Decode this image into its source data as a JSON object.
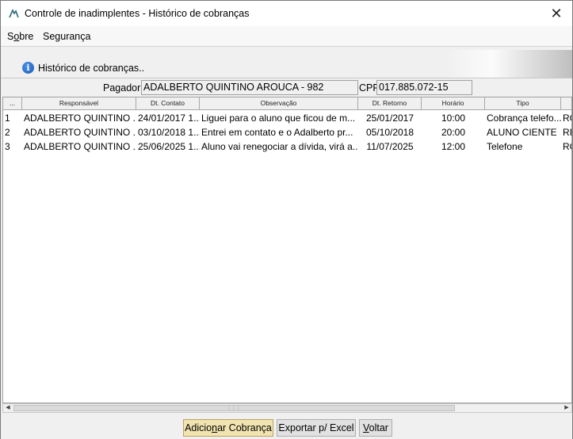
{
  "window": {
    "title": "Controle de inadimplentes - Histórico de cobranças",
    "close_glyph": "✕"
  },
  "menu": {
    "items": [
      {
        "pre": "S",
        "ul": "o",
        "post": "bre"
      },
      {
        "pre": "Segurança",
        "ul": "",
        "post": ""
      }
    ]
  },
  "banner": {
    "caption": "Histórico de cobranças.."
  },
  "payer": {
    "label": "Pagador:",
    "value": "ADALBERTO QUINTINO AROUCA - 982",
    "cpf_label": "CPF:",
    "cpf_value": "017.885.072-15"
  },
  "grid": {
    "columns": [
      "...",
      "Responsável",
      "Dt. Contato",
      "Observação",
      "Dt. Retorno",
      "Horário",
      "Tipo",
      ""
    ],
    "rows": [
      [
        "1",
        "ADALBERTO QUINTINO ...",
        "24/01/2017 1...",
        "Liguei para o aluno que ficou de m...",
        "25/01/2017",
        "10:00",
        "Cobrança telefo...",
        "RO"
      ],
      [
        "2",
        "ADALBERTO QUINTINO ...",
        "03/10/2018 1...",
        "Entrei em contato e o Adalberto pr...",
        "05/10/2018",
        "20:00",
        "ALUNO CIENTE",
        "RIC"
      ],
      [
        "3",
        "ADALBERTO QUINTINO ...",
        "25/06/2025 1...",
        "Aluno vai renegociar a dívida, virá a...",
        "11/07/2025",
        "12:00",
        "Telefone",
        "RO"
      ]
    ]
  },
  "buttons": {
    "add": {
      "pre": "Adicio",
      "ul": "n",
      "post": "ar Cobrança"
    },
    "export": {
      "pre": "Exportar p/ Excel",
      "ul": "",
      "post": ""
    },
    "back": {
      "pre": "",
      "ul": "V",
      "post": "oltar"
    }
  },
  "icons": {
    "app": "app-logo-icon",
    "info": "info-icon",
    "close": "close-icon",
    "scroll_left": "chevron-left-icon",
    "scroll_right": "chevron-right-icon"
  },
  "colors": {
    "primary_button": "#f2e4b0",
    "info_icon": "#1a5fb8"
  }
}
